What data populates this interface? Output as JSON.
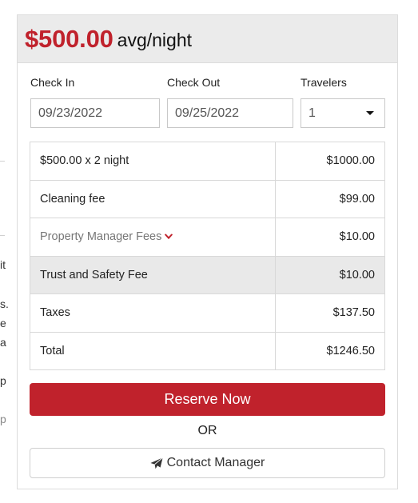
{
  "background_fragments": [
    "it",
    "s.",
    "e",
    "a",
    "p",
    "p"
  ],
  "booking": {
    "price": "$500.00",
    "price_unit": "avg/night",
    "check_in_label": "Check In",
    "check_out_label": "Check Out",
    "travelers_label": "Travelers",
    "check_in_value": "09/23/2022",
    "check_out_value": "09/25/2022",
    "travelers_value": "1",
    "fees": [
      {
        "label": "$500.00 x 2 night",
        "value": "$1000.00"
      },
      {
        "label": "Cleaning fee",
        "value": "$99.00"
      },
      {
        "label": "Property Manager Fees",
        "value": "$10.00"
      },
      {
        "label": "Trust and Safety Fee",
        "value": "$10.00"
      },
      {
        "label": "Taxes",
        "value": "$137.50"
      },
      {
        "label": "Total",
        "value": "$1246.50"
      }
    ],
    "reserve_label": "Reserve Now",
    "or_label": "OR",
    "contact_label": "Contact Manager"
  },
  "colors": {
    "accent": "#c0222c",
    "header_bg": "#ebebeb",
    "shaded_row": "#e9e9e9"
  }
}
